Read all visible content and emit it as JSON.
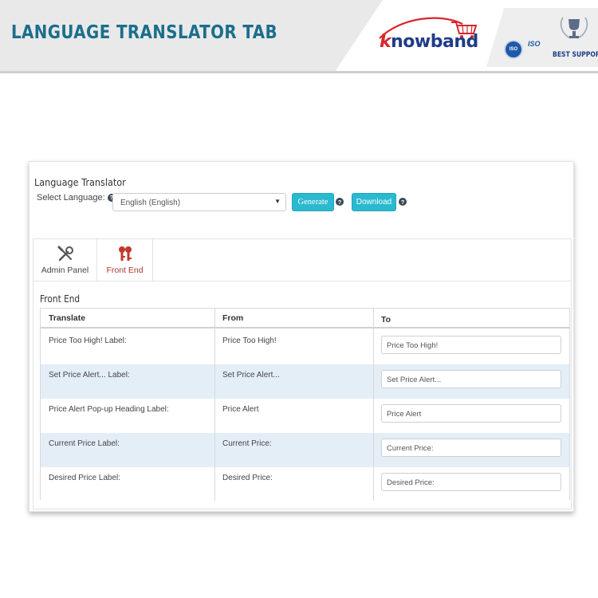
{
  "banner": {
    "title": "LANGUAGE TRANSLATOR TAB",
    "brand_initial": "k",
    "brand_rest": "nowband",
    "badge_iso_1": "ISO",
    "badge_iso_2": "ISO",
    "support_text": "BEST SUPPORT",
    "icons": [
      "shopping-cart-icon",
      "iso-badge-icon",
      "trophy-icon"
    ],
    "colors": {
      "title": "#1c6e8c",
      "brand_red": "#d8262d",
      "brand_blue": "#1f3c88"
    }
  },
  "translator": {
    "title": "Language Translator",
    "select_label": "Select Language:",
    "help_glyph": "?",
    "selected_language": "English (English)",
    "generate_label": "Generate",
    "download_label": "Download",
    "accent_color": "#2bb9cf"
  },
  "tabs": [
    {
      "label": "Admin Panel",
      "icon": "wrench-screwdriver-icon",
      "active": false
    },
    {
      "label": "Front End",
      "icon": "keys-icon",
      "active": true
    }
  ],
  "section": {
    "title": "Front End",
    "columns": [
      "Translate",
      "From",
      "To"
    ],
    "rows": [
      {
        "translate": "Price Too High! Label:",
        "from": "Price Too High!",
        "to": "Price Too High!"
      },
      {
        "translate": "Set Price Alert... Label:",
        "from": "Set Price Alert...",
        "to": "Set Price Alert..."
      },
      {
        "translate": "Price Alert Pop-up Heading Label:",
        "from": "Price Alert",
        "to": "Price Alert"
      },
      {
        "translate": "Current Price Label:",
        "from": "Current Price:",
        "to": "Current Price:"
      },
      {
        "translate": "Desired Price Label:",
        "from": "Desired Price:",
        "to": "Desired Price:"
      }
    ]
  }
}
